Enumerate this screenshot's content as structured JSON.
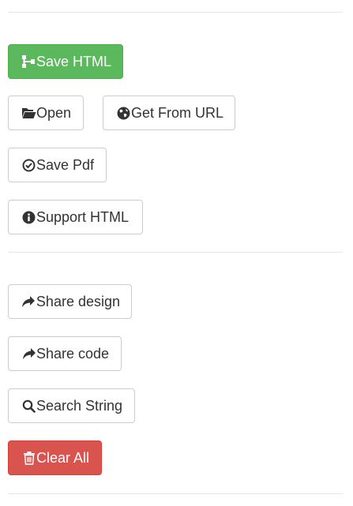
{
  "actions": {
    "save_html": "Save HTML",
    "open": "Open",
    "get_from_url": "Get From URL",
    "save_pdf": "Save Pdf",
    "support_html": "Support HTML",
    "share_design": "Share design",
    "share_code": "Share code",
    "search_string": "Search String",
    "clear_all": "Clear All"
  },
  "icons": {
    "save_html": "sitemap-icon",
    "open": "folder-open-icon",
    "get_from_url": "globe-icon",
    "save_pdf": "check-circle-icon",
    "support_html": "info-circle-icon",
    "share_design": "share-arrow-icon",
    "share_code": "share-arrow-icon",
    "search_string": "search-icon",
    "clear_all": "trash-icon"
  },
  "colors": {
    "success": "#5cb85c",
    "danger": "#d9534f",
    "default_border": "#cccccc",
    "text": "#333333"
  }
}
